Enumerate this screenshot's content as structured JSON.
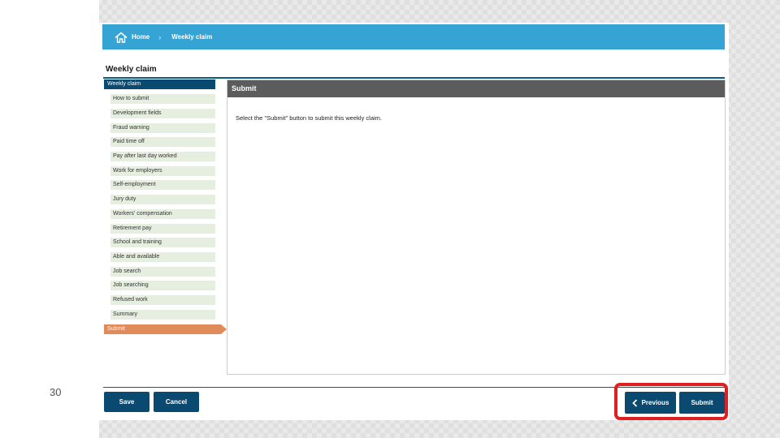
{
  "slide_number": "30",
  "breadcrumb": {
    "home": "Home",
    "current": "Weekly claim"
  },
  "page_title": "Weekly claim",
  "nav": {
    "header": "Weekly claim",
    "items": [
      "How to submit",
      "Development fields",
      "Fraud warning",
      "Paid time off",
      "Pay after last day worked",
      "Work for employers",
      "Self-employment",
      "Jury duty",
      "Workers' compensation",
      "Retirement pay",
      "School and training",
      "Able and available",
      "Job search",
      "Job searching",
      "Refused work",
      "Summary"
    ],
    "active": "Submit"
  },
  "panel": {
    "title": "Submit",
    "text": "Select the \"Submit\" button to submit this weekly claim."
  },
  "buttons": {
    "save": "Save",
    "cancel": "Cancel",
    "previous": "Previous",
    "submit": "Submit"
  },
  "colors": {
    "topbar": "#35a4d4",
    "navy": "#0b4a70",
    "nav_item_bg": "#e5eedf",
    "active_step": "#e08b5a",
    "panel_header": "#5c5c5c",
    "highlight": "#e02020"
  }
}
